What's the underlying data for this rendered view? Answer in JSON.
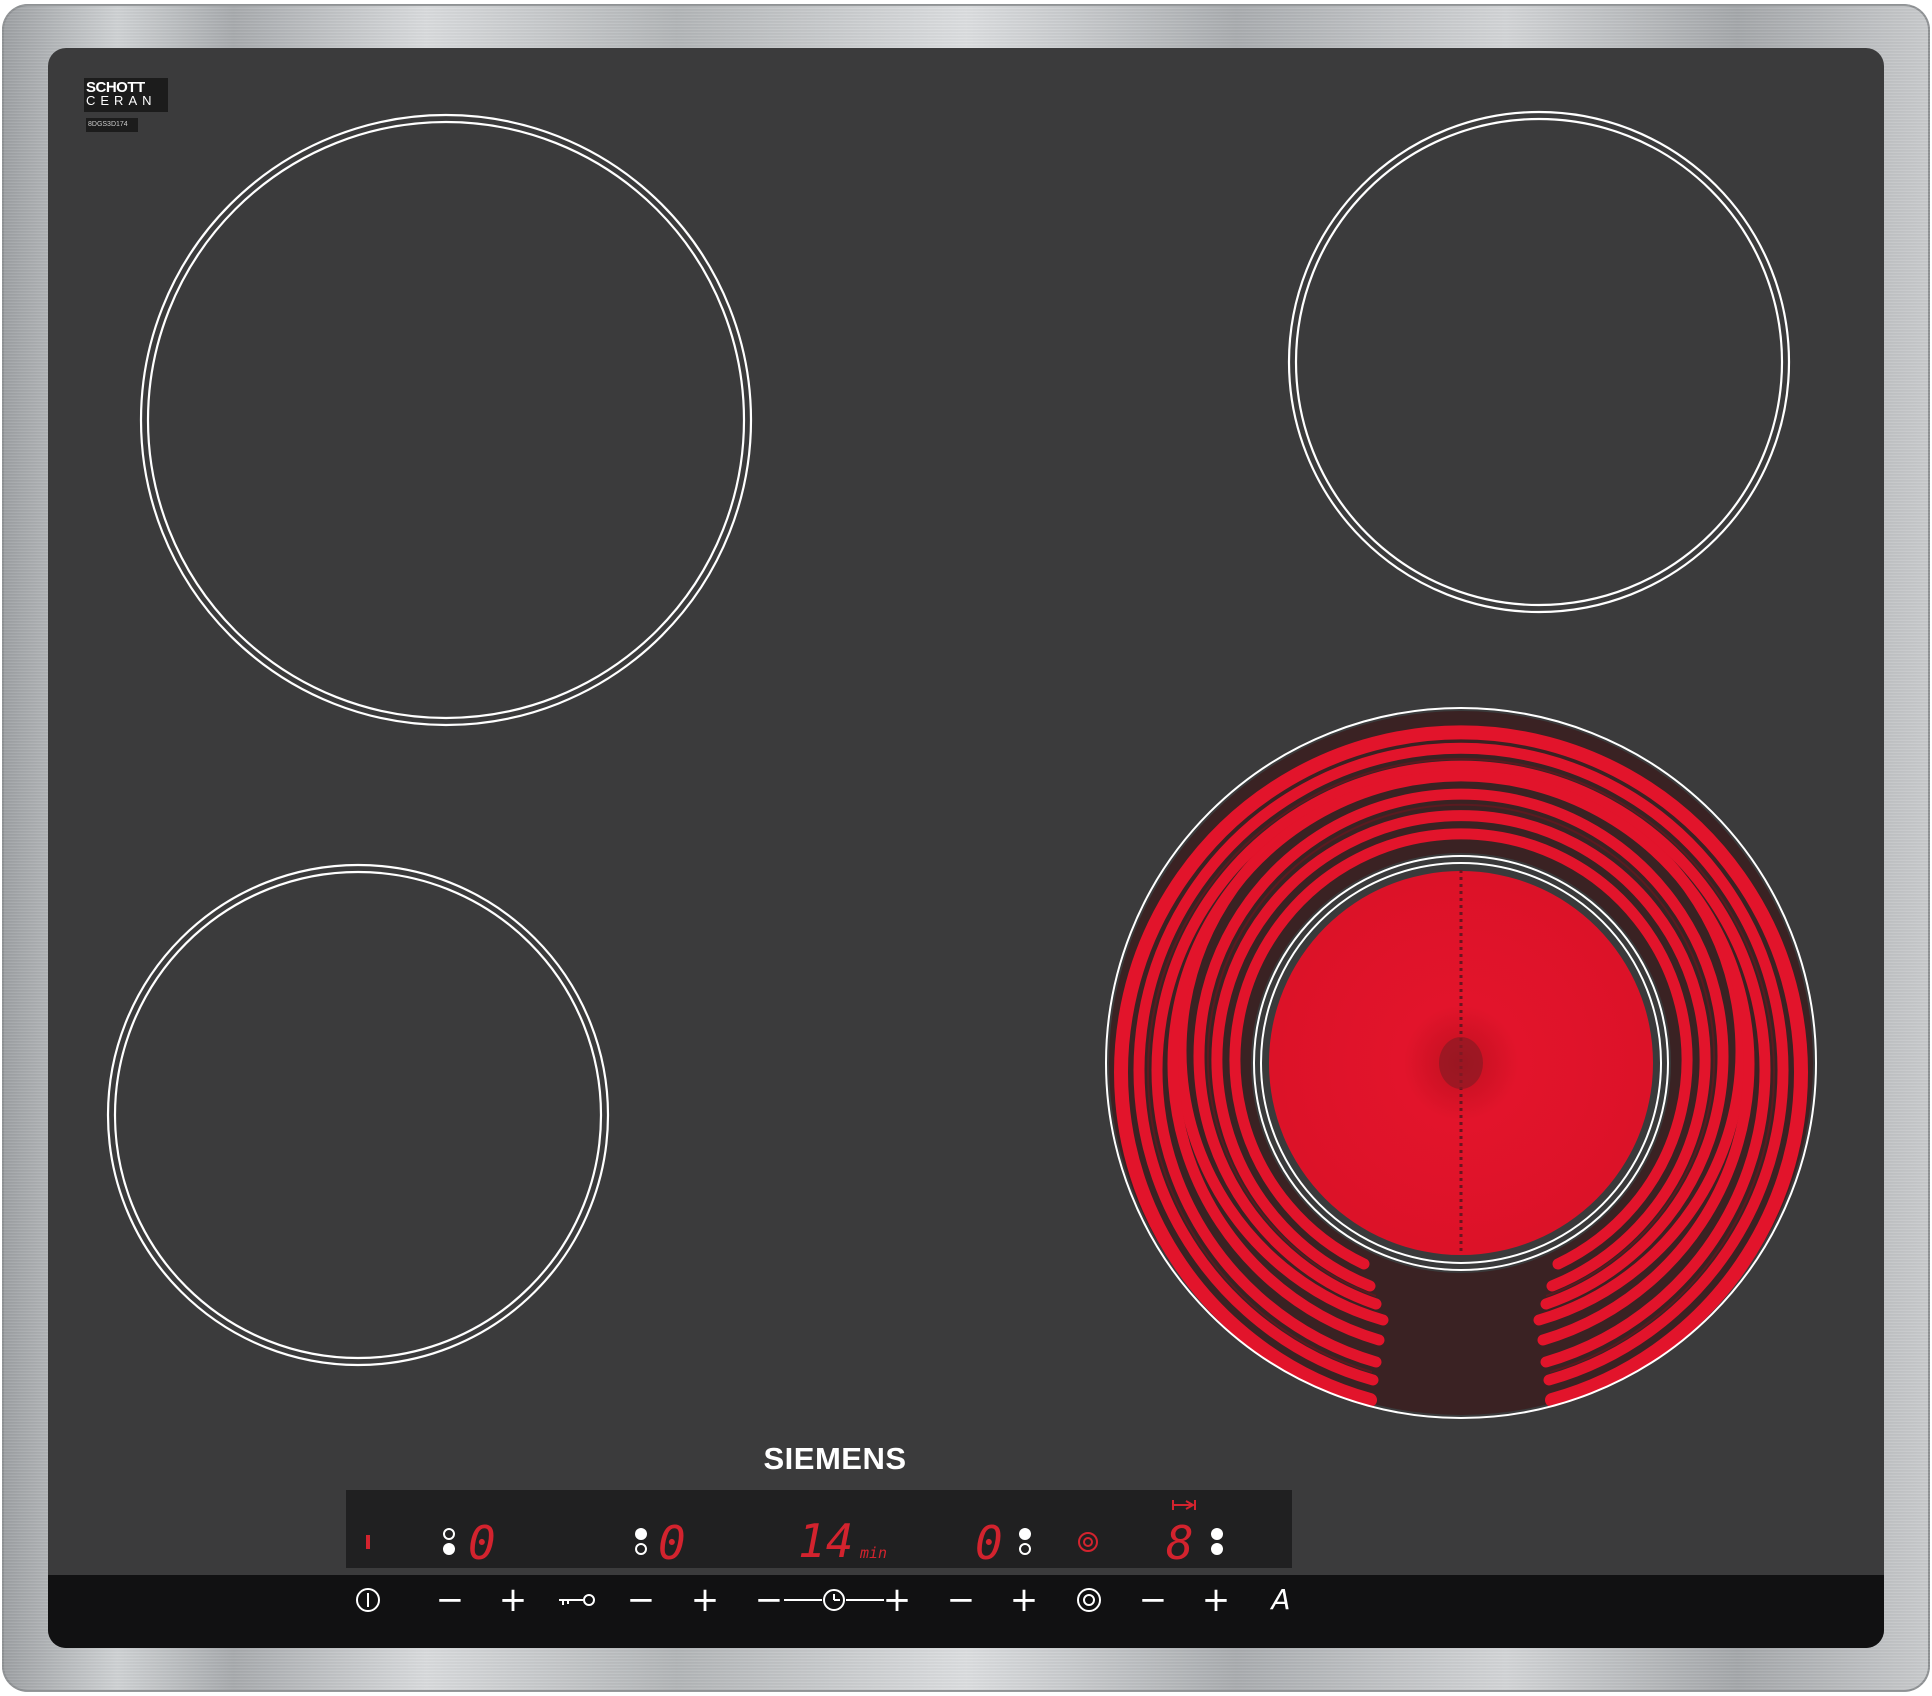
{
  "brand": "SIEMENS",
  "glass_logo": {
    "line1": "SCHOTT",
    "line2": "CERAN",
    "code": "8DGS3D174"
  },
  "colors": {
    "glass": "#3b3b3c",
    "frame": "#b8babc",
    "display_red": "#d3232e",
    "heater_red": "#e2142b"
  },
  "cooking_zones": [
    {
      "id": "front-left",
      "active": false
    },
    {
      "id": "rear-left",
      "active": false
    },
    {
      "id": "rear-right",
      "active": false
    },
    {
      "id": "front-right-dual",
      "active": true
    }
  ],
  "displays": {
    "zone1": "0",
    "zone2": "0",
    "timer": "14",
    "timer_unit": "min",
    "zone3": "0",
    "zone4": "8"
  },
  "controls": {
    "minus": "−",
    "plus": "+",
    "auto_label": "A"
  },
  "icons": [
    "power-icon",
    "key-lock-icon",
    "timer-clock-icon",
    "dual-zone-icon",
    "timer-arrow-icon"
  ]
}
